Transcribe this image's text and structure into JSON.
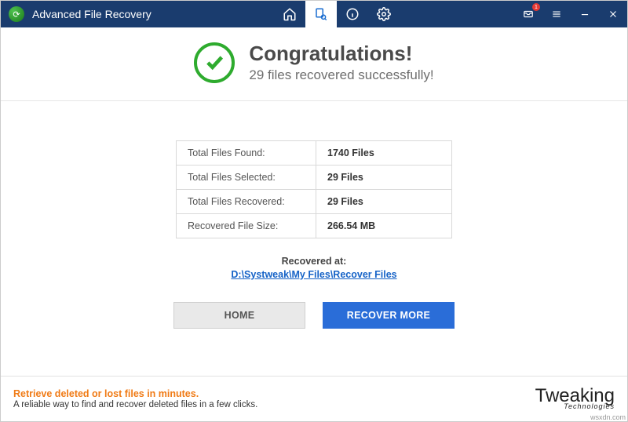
{
  "app": {
    "title": "Advanced File Recovery"
  },
  "notification": {
    "count": "1"
  },
  "hero": {
    "title": "Congratulations!",
    "subtitle": "29 files recovered successfully!"
  },
  "stats": {
    "rows": [
      {
        "label": "Total Files Found:",
        "value": "1740 Files"
      },
      {
        "label": "Total Files Selected:",
        "value": "29 Files"
      },
      {
        "label": "Total Files Recovered:",
        "value": "29 Files"
      },
      {
        "label": "Recovered File Size:",
        "value": "266.54 MB"
      }
    ]
  },
  "recovered": {
    "label": "Recovered at:",
    "path": "D:\\Systweak\\My Files\\Recover Files"
  },
  "buttons": {
    "home": "HOME",
    "recover_more": "RECOVER MORE"
  },
  "footer": {
    "headline": "Retrieve deleted or lost files in minutes.",
    "sub": "A reliable way to find and recover deleted files in a few clicks.",
    "brand_top": "Tweaking",
    "brand_bottom": "Technologies"
  },
  "attribution": "wsxdn.com"
}
